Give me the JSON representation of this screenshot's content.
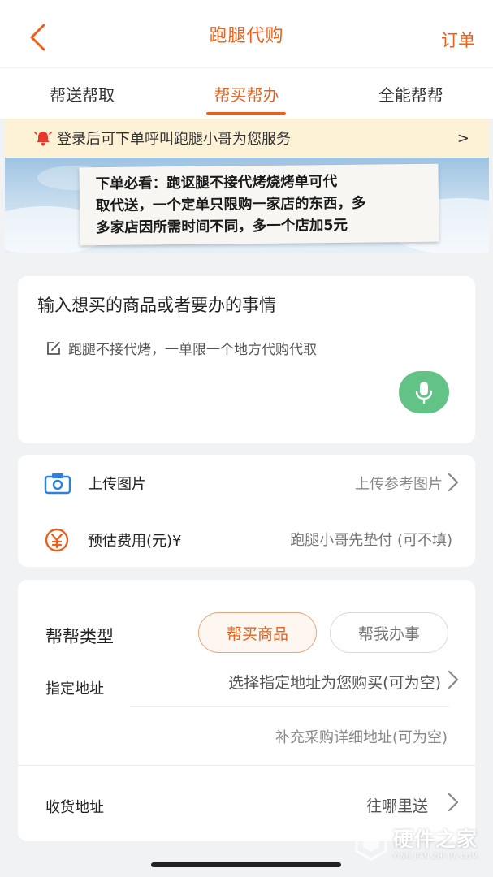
{
  "header": {
    "title": "跑腿代购",
    "orders_label": "订单"
  },
  "tabs": [
    {
      "label": "帮送帮取"
    },
    {
      "label": "帮买帮办"
    },
    {
      "label": "全能帮帮"
    }
  ],
  "notice": {
    "text": "登录后可下单呼叫跑腿小哥为您服务",
    "chevron": ">"
  },
  "banner": {
    "lines": [
      "下单必看：跑讴腿不接代烤烧烤单可代",
      "取代送，一个定单只限购一家店的东西，多",
      "多家店因所需时间不同，多一个店加5元"
    ]
  },
  "request_input": {
    "title": "输入想买的商品或者要办的事情",
    "placeholder": "跑腿不接代烤，一单限一个地方代购代取"
  },
  "upload": {
    "label": "上传图片",
    "value": "上传参考图片"
  },
  "fee": {
    "label": "预估费用(元)¥",
    "placeholder": "跑腿小哥先垫付 (可不填)"
  },
  "help_type": {
    "label": "帮帮类型",
    "options": [
      "帮买商品",
      "帮我办事"
    ],
    "selected": "帮买商品"
  },
  "address": {
    "label": "指定地址",
    "select_text": "选择指定地址为您购买(可为空)",
    "detail_placeholder": "补充采购详细地址(可为空)"
  },
  "delivery": {
    "label": "收货地址",
    "value": "往哪里送"
  },
  "watermark": {
    "main": "硬件之家",
    "sub": "YING JIAN ZHI JIA.COM"
  },
  "colors": {
    "accent": "#e9611c",
    "mic_green": "#63c386",
    "notice_bg": "#fdf1d6"
  }
}
